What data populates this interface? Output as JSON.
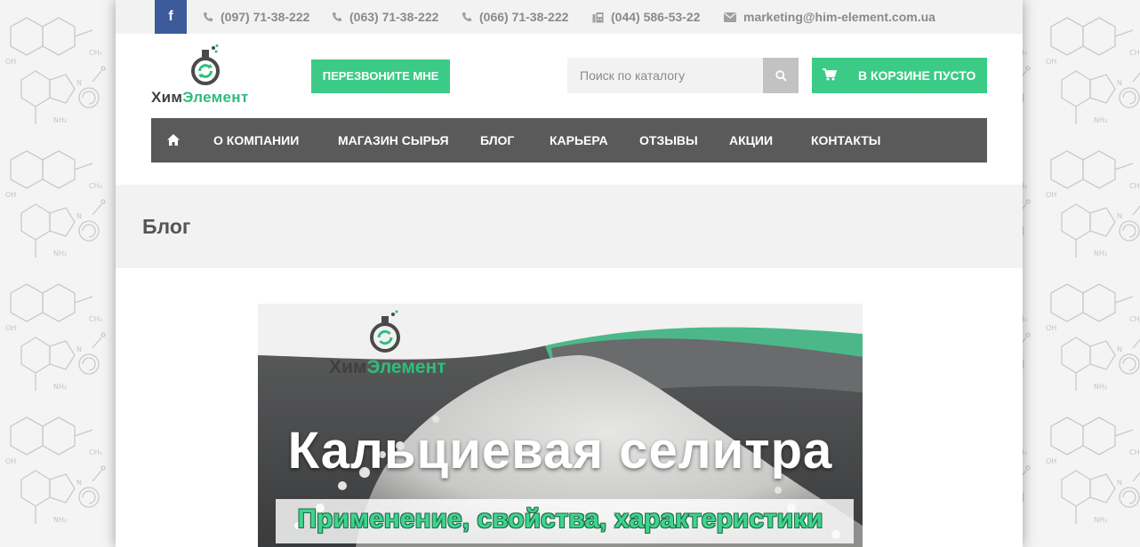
{
  "topbar": {
    "facebook_glyph": "f",
    "phone_1": "(097) 71-38-222",
    "phone_2": "(063) 71-38-222",
    "phone_3": "(066) 71-38-222",
    "fax": "(044) 586-53-22",
    "email": "marketing@him-element.com.ua"
  },
  "header": {
    "logo_part1": "Хим",
    "logo_part2": "Элемент",
    "callback_label": "ПЕРЕЗВОНИТЕ МНЕ",
    "search_placeholder": "Поиск по каталогу",
    "search_value": "",
    "cart_label": "В КОРЗИНЕ ПУСТО"
  },
  "nav": {
    "items": [
      {
        "label": "О КОМПАНИИ"
      },
      {
        "label": "МАГАЗИН СЫРЬЯ"
      },
      {
        "label": "БЛОГ"
      },
      {
        "label": "КАРЬЕРА"
      },
      {
        "label": "ОТЗЫВЫ"
      },
      {
        "label": "АКЦИИ"
      },
      {
        "label": "КОНТАКТЫ"
      }
    ]
  },
  "page": {
    "title": "Блог"
  },
  "banner": {
    "logo_part1": "Хим",
    "logo_part2": "Элемент",
    "title": "Кальциевая селитра",
    "subtitle": "Применение, свойства, характеристики"
  },
  "icons": {
    "facebook": "facebook-icon",
    "phone": "phone-icon",
    "fax": "fax-icon",
    "email": "envelope-icon",
    "search": "search-icon",
    "cart": "cart-icon",
    "home": "home-icon"
  },
  "colors": {
    "accent_green": "#3ccb86",
    "facebook_blue": "#3b5b9a",
    "nav_bg": "#5a5a5a",
    "topbar_bg": "#f2f2f2",
    "muted_text": "#8a8a8a"
  }
}
